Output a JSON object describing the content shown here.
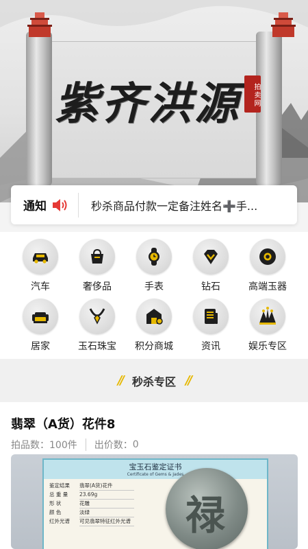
{
  "banner": {
    "title": "紫齐洪源",
    "seal_text": "拍卖网"
  },
  "notice": {
    "label": "通知",
    "text": "秒杀商品付款一定备注姓名➕手..."
  },
  "categories": [
    {
      "label": "汽车",
      "icon": "car-icon"
    },
    {
      "label": "奢侈品",
      "icon": "handbag-icon"
    },
    {
      "label": "手表",
      "icon": "watch-icon"
    },
    {
      "label": "钻石",
      "icon": "diamond-icon"
    },
    {
      "label": "高端玉器",
      "icon": "jade-disc-icon"
    },
    {
      "label": "居家",
      "icon": "sofa-icon"
    },
    {
      "label": "玉石珠宝",
      "icon": "necklace-icon"
    },
    {
      "label": "积分商城",
      "icon": "shop-icon"
    },
    {
      "label": "资讯",
      "icon": "news-icon"
    },
    {
      "label": "娱乐专区",
      "icon": "tent-icon"
    }
  ],
  "section": {
    "title": "秒杀专区",
    "decoration": "//"
  },
  "product": {
    "title": "翡翠（A货）花件8",
    "bid_count_label": "拍品数：",
    "bid_count": "100件",
    "offer_label": "出价数：",
    "offer_count": "0",
    "certificate": {
      "title": "宝玉石鉴定证书",
      "subtitle": "Certificate of Gems & Jades",
      "rows": [
        {
          "k": "鉴定结果",
          "v": "翡翠(A货)花件"
        },
        {
          "k": "总 重 量",
          "v": "23.69g"
        },
        {
          "k": "形    状",
          "v": "花雕"
        },
        {
          "k": "颜    色",
          "v": "淡绿"
        },
        {
          "k": "红外光谱",
          "v": "可见翡翠特征红外光谱"
        }
      ],
      "jade_char": "禄"
    }
  },
  "colors": {
    "accent": "#e6b800",
    "speaker": "#e53935",
    "seal": "#b3241e"
  }
}
